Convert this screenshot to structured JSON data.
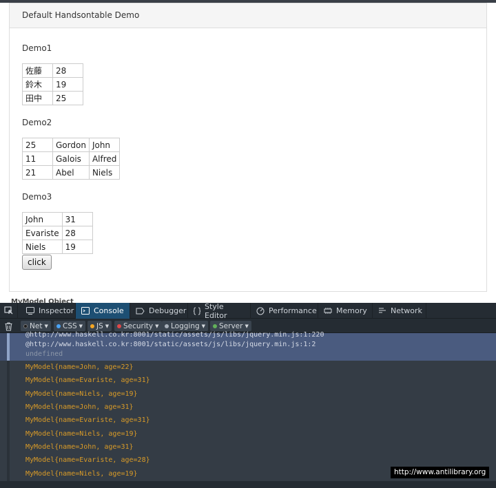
{
  "page": {
    "heading": "Default Handsontable Demo",
    "demo1": {
      "title": "Demo1",
      "rows": [
        [
          "佐藤",
          "28"
        ],
        [
          "鈴木",
          "19"
        ],
        [
          "田中",
          "25"
        ]
      ]
    },
    "demo2": {
      "title": "Demo2",
      "rows": [
        [
          "25",
          "Gordon",
          "John"
        ],
        [
          "11",
          "Galois",
          "Alfred"
        ],
        [
          "21",
          "Abel",
          "Niels"
        ]
      ]
    },
    "demo3": {
      "title": "Demo3",
      "rows": [
        [
          "John",
          "31"
        ],
        [
          "Evariste",
          "28"
        ],
        [
          "Niels",
          "19"
        ]
      ]
    },
    "click_label": "click",
    "clipped_text": "MyModel Object"
  },
  "devtools": {
    "tabs": [
      {
        "label": "Inspector",
        "icon": "inspector-icon"
      },
      {
        "label": "Console",
        "icon": "console-icon",
        "active": true
      },
      {
        "label": "Debugger",
        "icon": "debugger-icon"
      },
      {
        "label": "Style Editor",
        "icon": "style-editor-icon"
      },
      {
        "label": "Performance",
        "icon": "performance-icon"
      },
      {
        "label": "Memory",
        "icon": "memory-icon"
      },
      {
        "label": "Network",
        "icon": "network-icon"
      }
    ],
    "filters": [
      {
        "label": "Net",
        "color": "#1c1c1c"
      },
      {
        "label": "CSS",
        "color": "#4aa3f5"
      },
      {
        "label": "JS",
        "color": "#f5a623"
      },
      {
        "label": "Security",
        "color": "#e04848"
      },
      {
        "label": "Logging",
        "color": "#a8b0ba"
      },
      {
        "label": "Server",
        "color": "#62b05a"
      }
    ],
    "output": {
      "trace": [
        "@http://www.haskell.co.kr:8001/static/assets/js/libs/jquery.min.js:1:220",
        "@http://www.haskell.co.kr:8001/static/assets/js/libs/jquery.min.js:1:2"
      ],
      "undefined_text": "undefined",
      "logs": [
        "MyModel{name=John, age=22}",
        "MyModel{name=Evariste, age=31}",
        "MyModel{name=Niels, age=19}",
        "MyModel{name=John, age=31}",
        "MyModel{name=Evariste, age=31}",
        "MyModel{name=Niels, age=19}",
        "MyModel{name=John, age=31}",
        "MyModel{name=Evariste, age=28}",
        "MyModel{name=Niels, age=19}"
      ]
    },
    "colors": {
      "active_tab": "#1d4f73",
      "log_text": "#d99b28",
      "selected_block": "#4a5b7f"
    }
  },
  "watermark": "http://www.antilibrary.org"
}
